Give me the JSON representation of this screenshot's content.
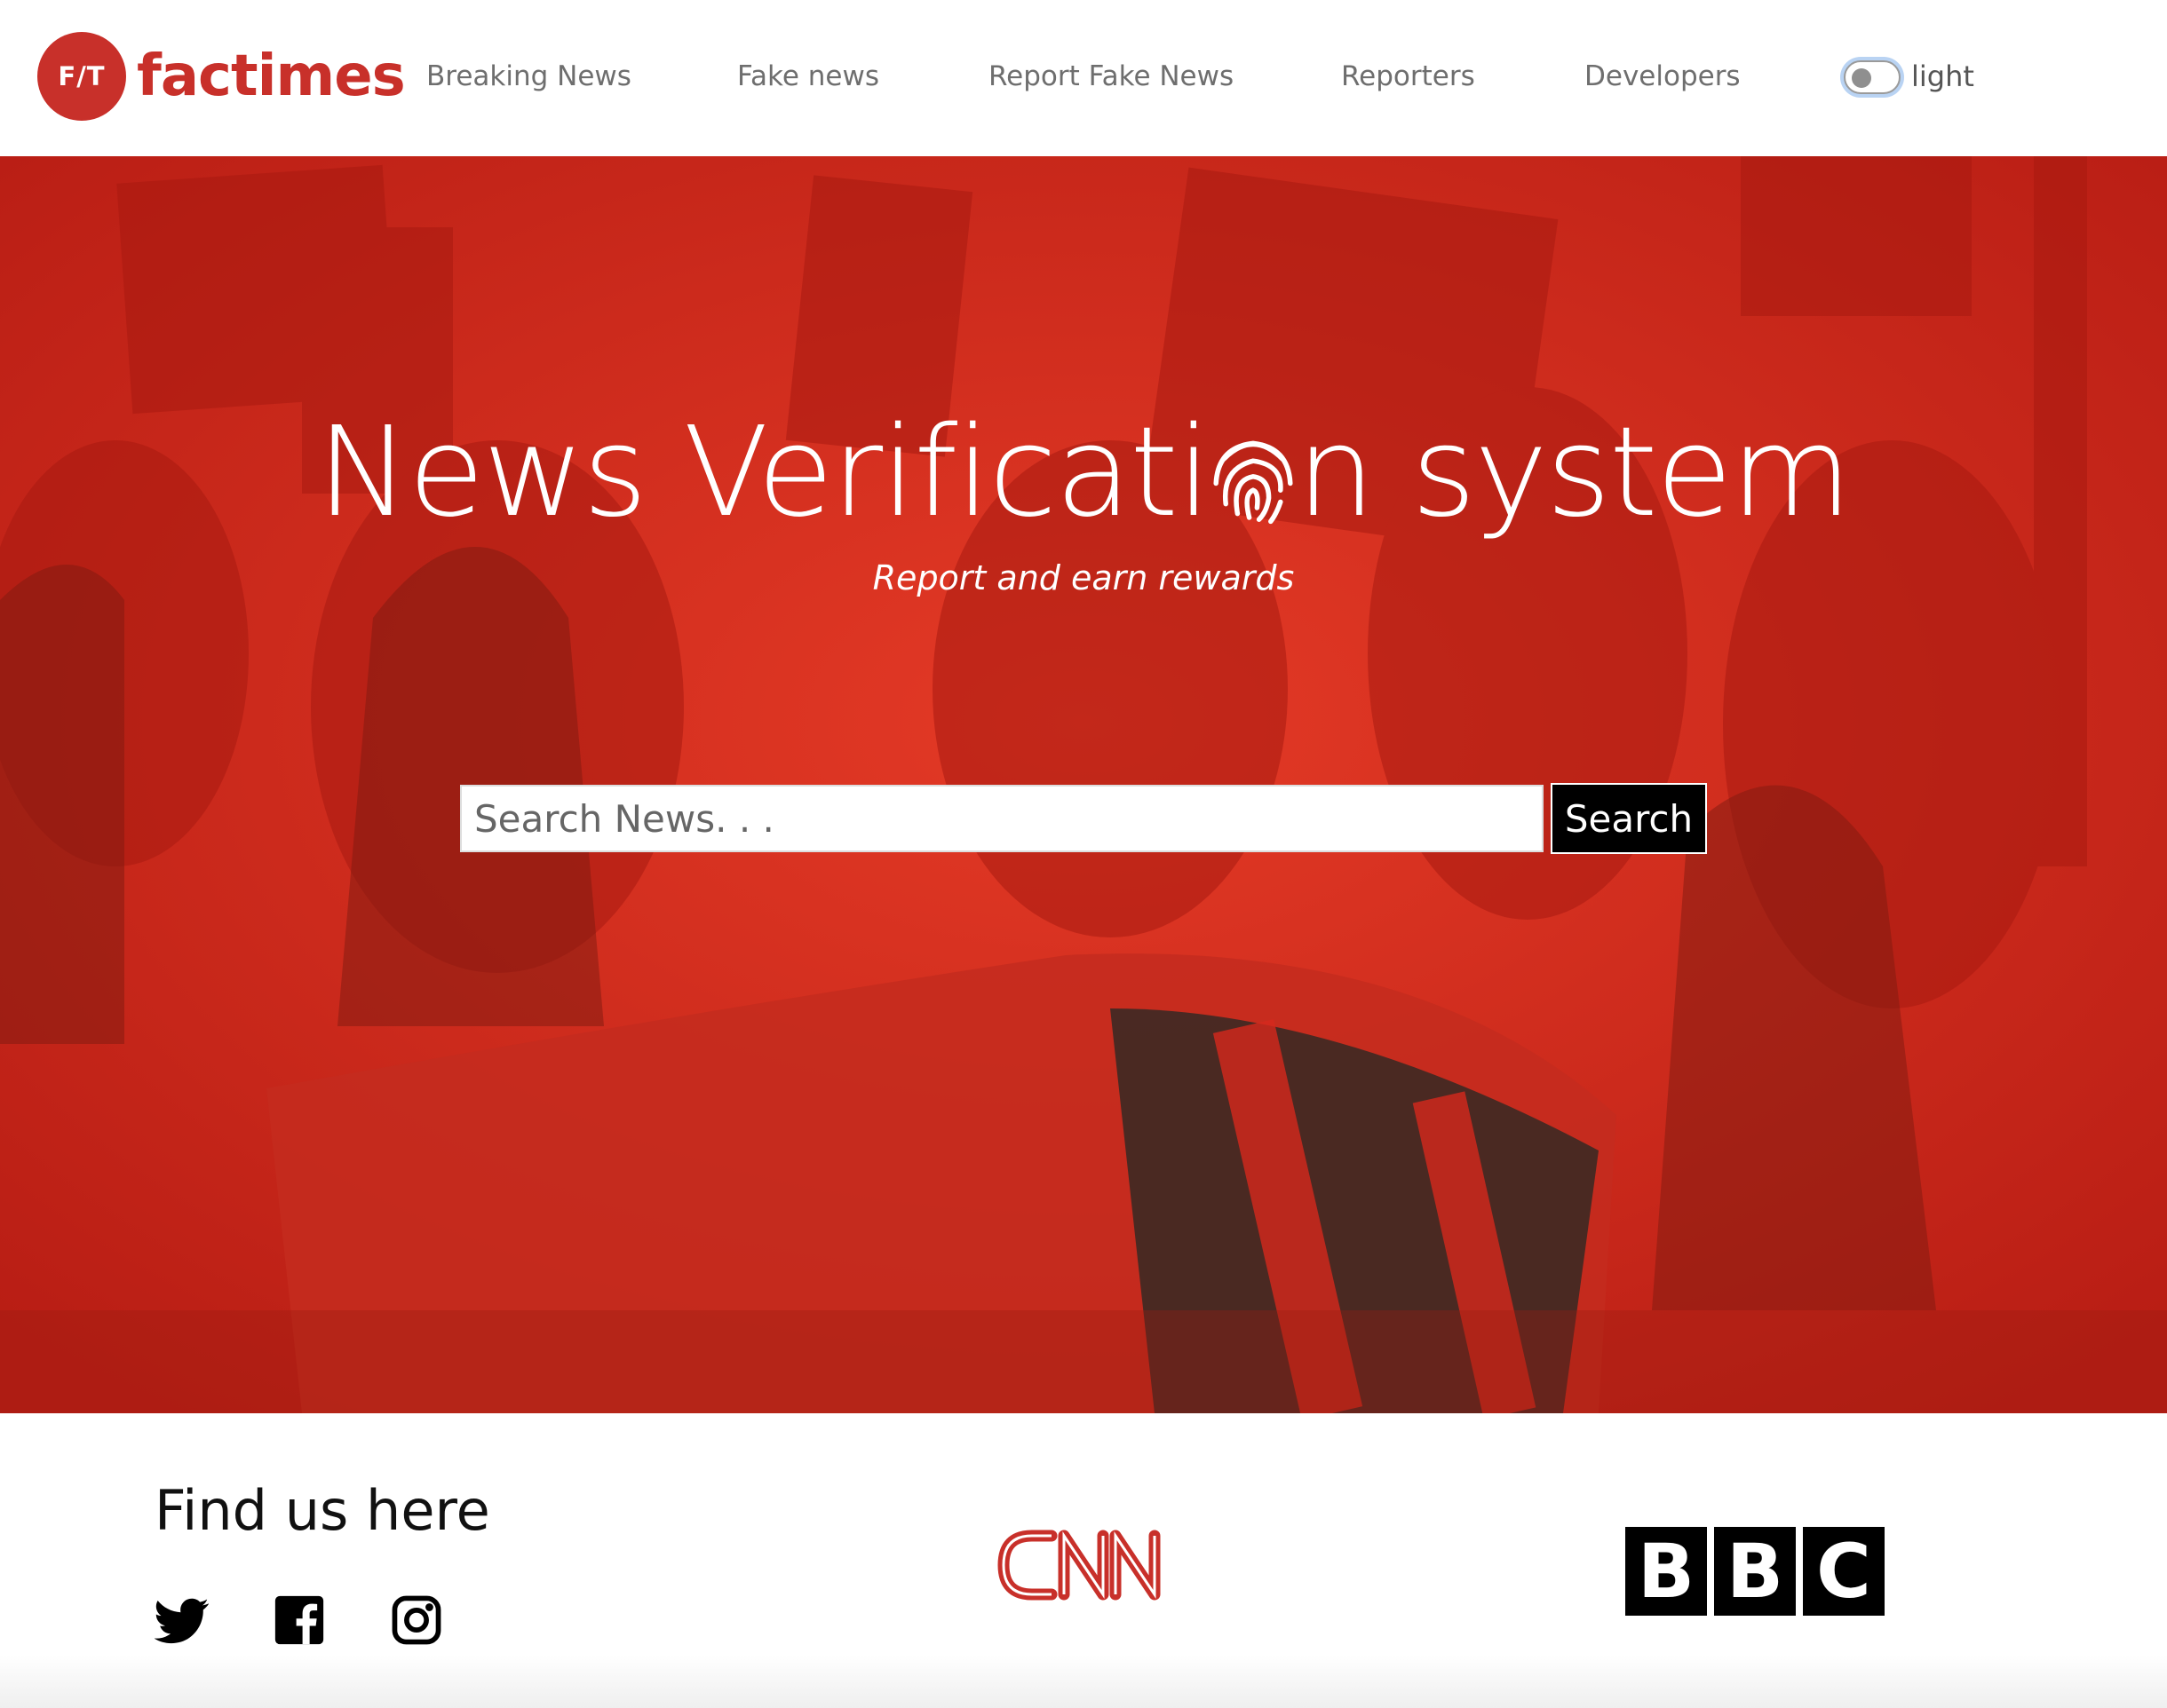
{
  "brand": {
    "badge": "F/T",
    "name": "factimes",
    "color": "#c8302a"
  },
  "nav": {
    "items": [
      {
        "label": "Breaking News"
      },
      {
        "label": "Fake news"
      },
      {
        "label": "Report Fake News"
      },
      {
        "label": "Reporters"
      },
      {
        "label": "Developers"
      }
    ],
    "theme_toggle": {
      "label": "light",
      "state": "off"
    }
  },
  "hero": {
    "title_before": "News Verificati",
    "title_icon": "fingerprint-icon",
    "title_after": "n system",
    "subtitle": "Report and earn rewards",
    "overlay_color": "#d6291d"
  },
  "search": {
    "placeholder": "Search News. . .",
    "value": "",
    "button_label": "Search"
  },
  "footer": {
    "heading": "Find us here",
    "social_icons": [
      "twitter-icon",
      "facebook-icon",
      "instagram-icon"
    ],
    "partners": [
      {
        "name": "CNN",
        "icon": "cnn-logo",
        "color": "#c8302a"
      },
      {
        "name": "BBC",
        "letters": [
          "B",
          "B",
          "C"
        ]
      }
    ]
  }
}
